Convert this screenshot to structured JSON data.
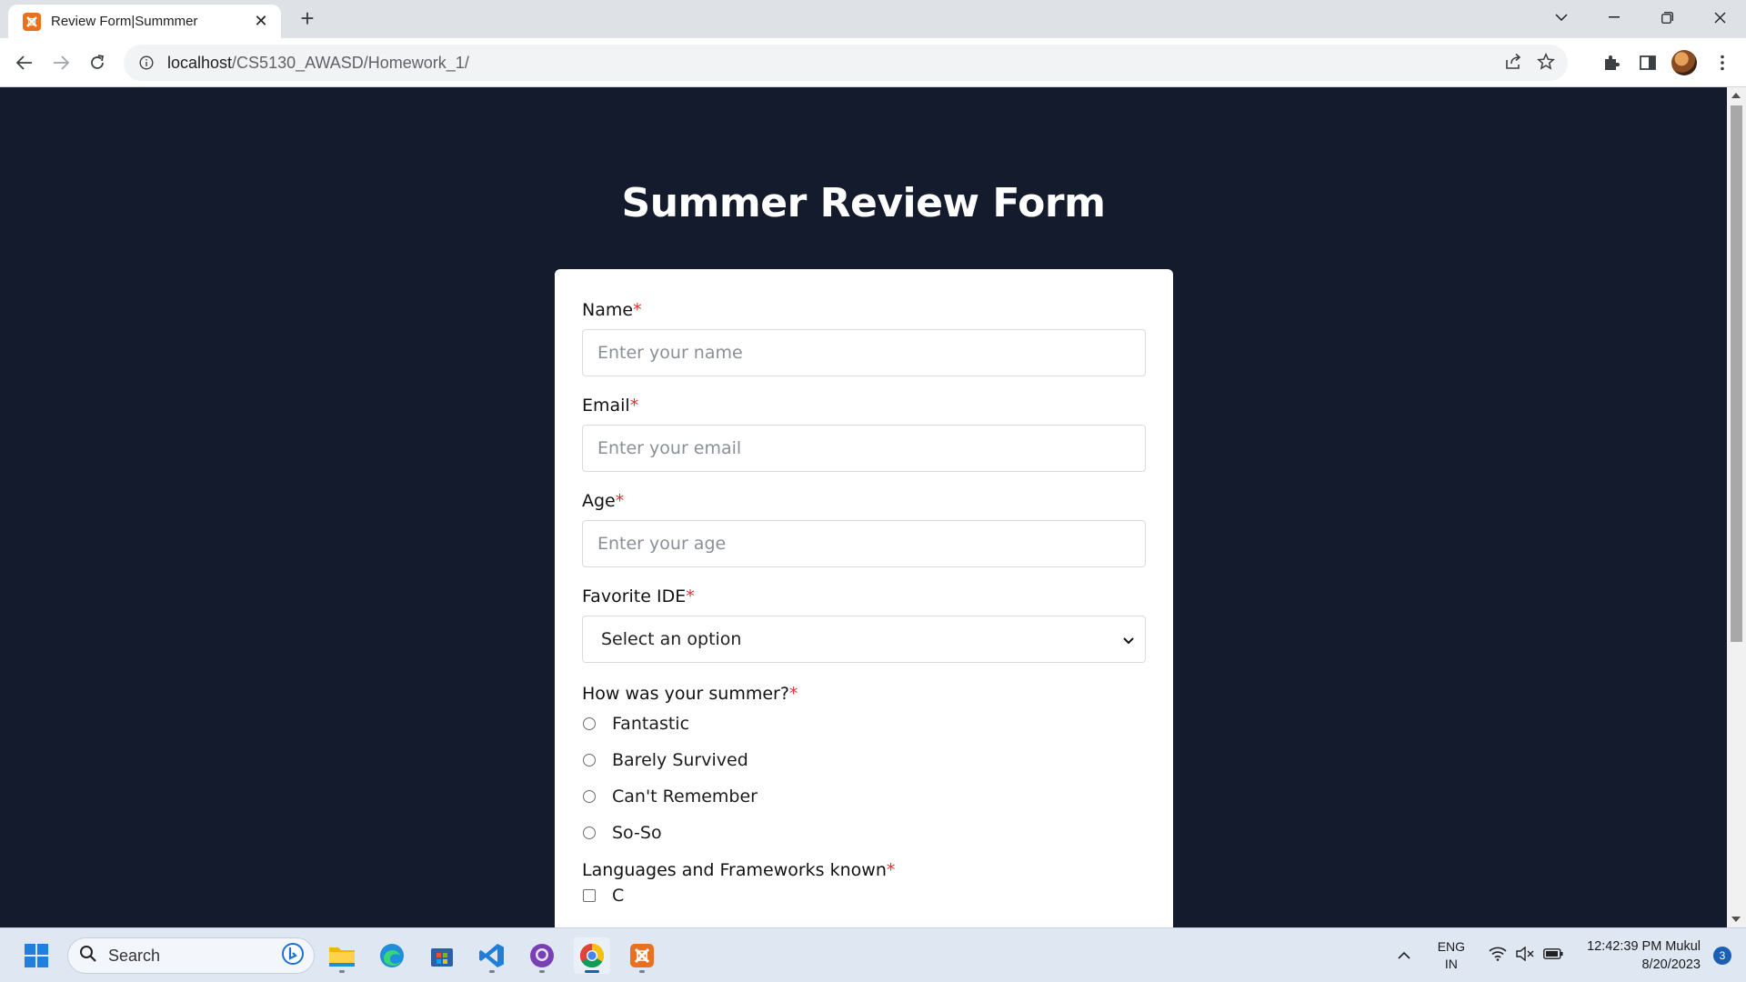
{
  "browser": {
    "tab_title": "Review Form|Summmer",
    "url_host": "localhost",
    "url_path": "/CS5130_AWASD/Homework_1/"
  },
  "page": {
    "title": "Summer Review Form",
    "fields": {
      "name": {
        "label": "Name",
        "required_mark": "*",
        "placeholder": "Enter your name",
        "value": ""
      },
      "email": {
        "label": "Email",
        "required_mark": "*",
        "placeholder": "Enter your email",
        "value": ""
      },
      "age": {
        "label": "Age",
        "required_mark": "*",
        "placeholder": "Enter your age",
        "value": ""
      },
      "ide": {
        "label": "Favorite IDE",
        "required_mark": "*",
        "selected": "Select an option"
      }
    },
    "summer": {
      "label": "How was your summer?",
      "required_mark": "*",
      "options": [
        "Fantastic",
        "Barely Survived",
        "Can't Remember",
        "So-So"
      ]
    },
    "languages": {
      "label": "Languages and Frameworks known",
      "required_mark": "*",
      "options": [
        "C"
      ]
    }
  },
  "taskbar": {
    "search_placeholder": "Search",
    "lang_top": "ENG",
    "lang_bottom": "IN",
    "time": "12:42:39 PM Mukul",
    "date": "8/20/2023",
    "notification_count": "3"
  },
  "colors": {
    "page_background": "#141b2d",
    "required_mark": "#dd3333",
    "tab_favicon": "#e8701f"
  }
}
